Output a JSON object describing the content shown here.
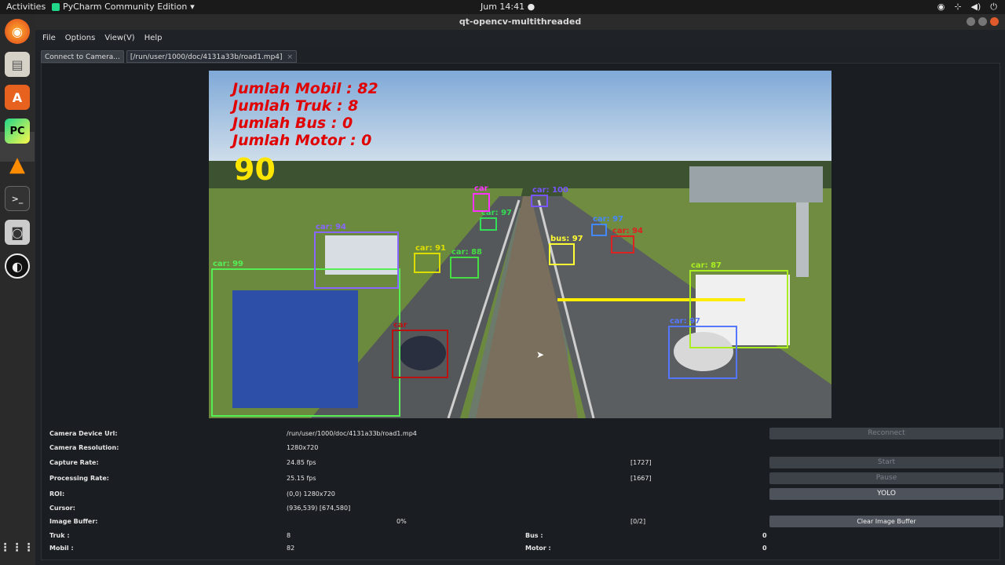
{
  "topbar": {
    "activities": "Activities",
    "app_menu": "PyCharm Community Edition",
    "clock": "Jum 14:41"
  },
  "window": {
    "title": "qt-opencv-multithreaded"
  },
  "menubar": {
    "items": [
      "File",
      "Options",
      "View(V)",
      "Help"
    ]
  },
  "tabs": [
    {
      "label": "Connect to Camera..."
    },
    {
      "label": "[/run/user/1000/doc/4131a33b/road1.mp4]"
    }
  ],
  "video": {
    "overlay": {
      "mobil": "Jumlah Mobil : 82",
      "truk": "Jumlah Truk : 8",
      "bus": "Jumlah Bus : 0",
      "motor": "Jumlah Motor : 0",
      "total": "90"
    },
    "detections": [
      {
        "label": "car: 99",
        "color": "#55ee55"
      },
      {
        "label": "car: 94",
        "color": "#8866ff"
      },
      {
        "label": "car: 91",
        "color": "#dddd00"
      },
      {
        "label": "car: 88",
        "color": "#44dd44"
      },
      {
        "label": "bus: 97",
        "color": "#ffff33"
      },
      {
        "label": "car: 94",
        "color": "#dd2222"
      },
      {
        "label": "car: 87",
        "color": "#aaee22"
      },
      {
        "label": "car: 97",
        "color": "#5577ff"
      },
      {
        "label": "car: 97",
        "color": "#4488ff"
      },
      {
        "label": "car: 100",
        "color": "#7755ff"
      },
      {
        "label": "car: 97",
        "color": "#33dd55"
      },
      {
        "label": "car",
        "color": "#ff33ff"
      },
      {
        "label": "car",
        "color": "#bb1111"
      }
    ]
  },
  "info": {
    "device_url_label": "Camera Device Url:",
    "device_url_value": "/run/user/1000/doc/4131a33b/road1.mp4",
    "resolution_label": "Camera Resolution:",
    "resolution_value": "1280x720",
    "capture_label": "Capture Rate:",
    "capture_value": "24.85 fps",
    "capture_frames": "[1727]",
    "processing_label": "Processing Rate:",
    "processing_value": "25.15 fps",
    "processing_frames": "[1667]",
    "roi_label": "ROI:",
    "roi_value": "(0,0) 1280x720",
    "cursor_label": "Cursor:",
    "cursor_value": "(936,539) [674,580]",
    "buffer_label": "Image Buffer:",
    "buffer_pct": "0%",
    "buffer_count": "[0/2]",
    "truk_label": "Truk     :",
    "truk_value": "8",
    "bus_label": "Bus     :",
    "bus_value": "0",
    "mobil_label": "Mobil    :",
    "mobil_value": "82",
    "motor_label": "Motor    :",
    "motor_value": "0"
  },
  "buttons": {
    "reconnect": "Reconnect",
    "start": "Start",
    "pause": "Pause",
    "yolo": "YOLO",
    "clear_buffer": "Clear Image Buffer"
  },
  "colors": {
    "overlay_red": "#e00000",
    "overlay_yellow": "#ffe600",
    "accent_orange": "#e05a2b"
  }
}
